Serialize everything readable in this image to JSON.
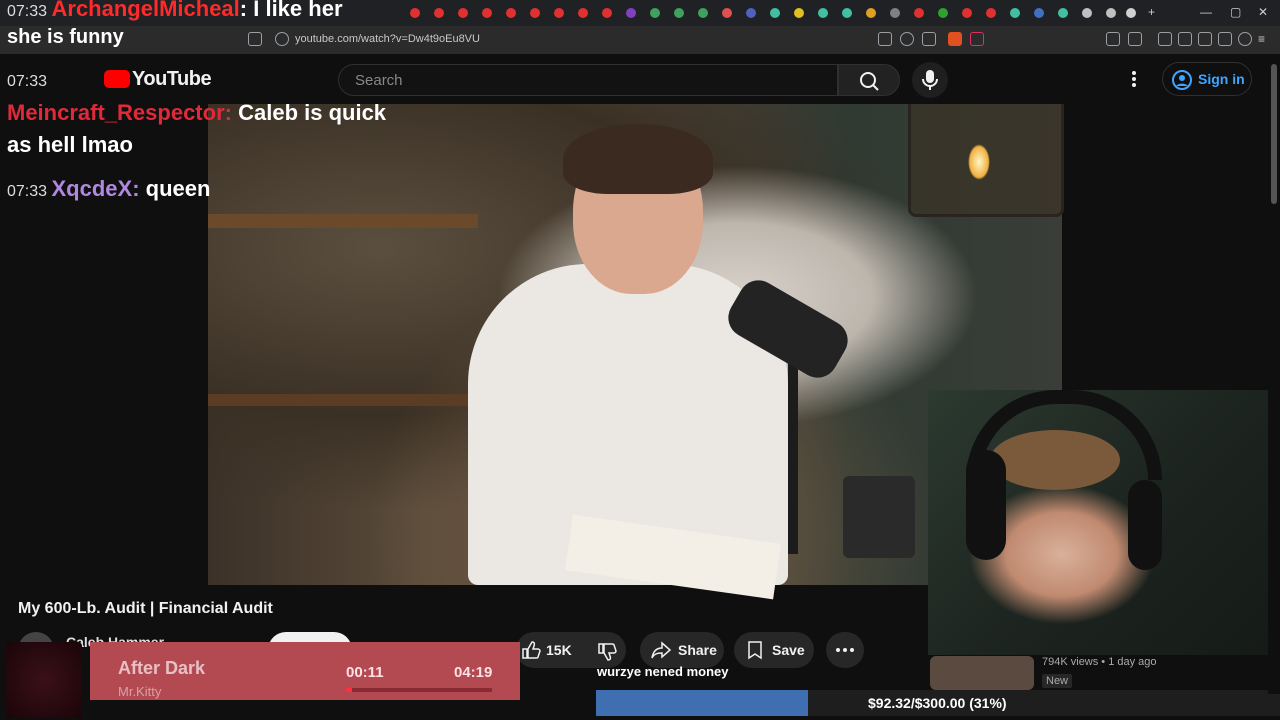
{
  "browser": {
    "url": "youtube.com/watch?v=Dw4t9oEu8VU"
  },
  "youtube": {
    "logo_text": "YouTube",
    "search_placeholder": "Search",
    "sign_in_label": "Sign in"
  },
  "chat": [
    {
      "time": "07:33",
      "user": "ArchangelMicheal",
      "text": "I like her",
      "user_color": "#ff2a2a"
    },
    {
      "time": "",
      "user": "",
      "text": "she is funny",
      "user_color": "#ffffff"
    },
    {
      "time": "07:33",
      "user": "Meincraft_Respector",
      "text": "Caleb is quick",
      "user_color": "#e02a3a"
    },
    {
      "time": "",
      "user": "",
      "text": "as hell lmao",
      "user_color": "#ffffff"
    },
    {
      "time": "07:33",
      "user": "XqcdeX",
      "text": "queen",
      "user_color": "#b088e0"
    }
  ],
  "video": {
    "title": "My 600-Lb. Audit | Financial Audit",
    "channel": "Caleb Hammer",
    "likes": "15K",
    "share_label": "Share",
    "save_label": "Save"
  },
  "music": {
    "title": "After Dark",
    "artist": "Mr.Kitty",
    "current": "00:11",
    "total": "04:19",
    "progress": 0.04
  },
  "donation": {
    "message": "wurzye nened money",
    "text": "$92.32/$300.00 (31%)",
    "progress": 0.31
  },
  "recommendation": {
    "views": "794K views • 1 day ago",
    "badge": "New"
  },
  "colors": {
    "accent_blue": "#3ea6ff",
    "music_bg": "#b34a52",
    "donation_fill": "#3f6fb0"
  }
}
